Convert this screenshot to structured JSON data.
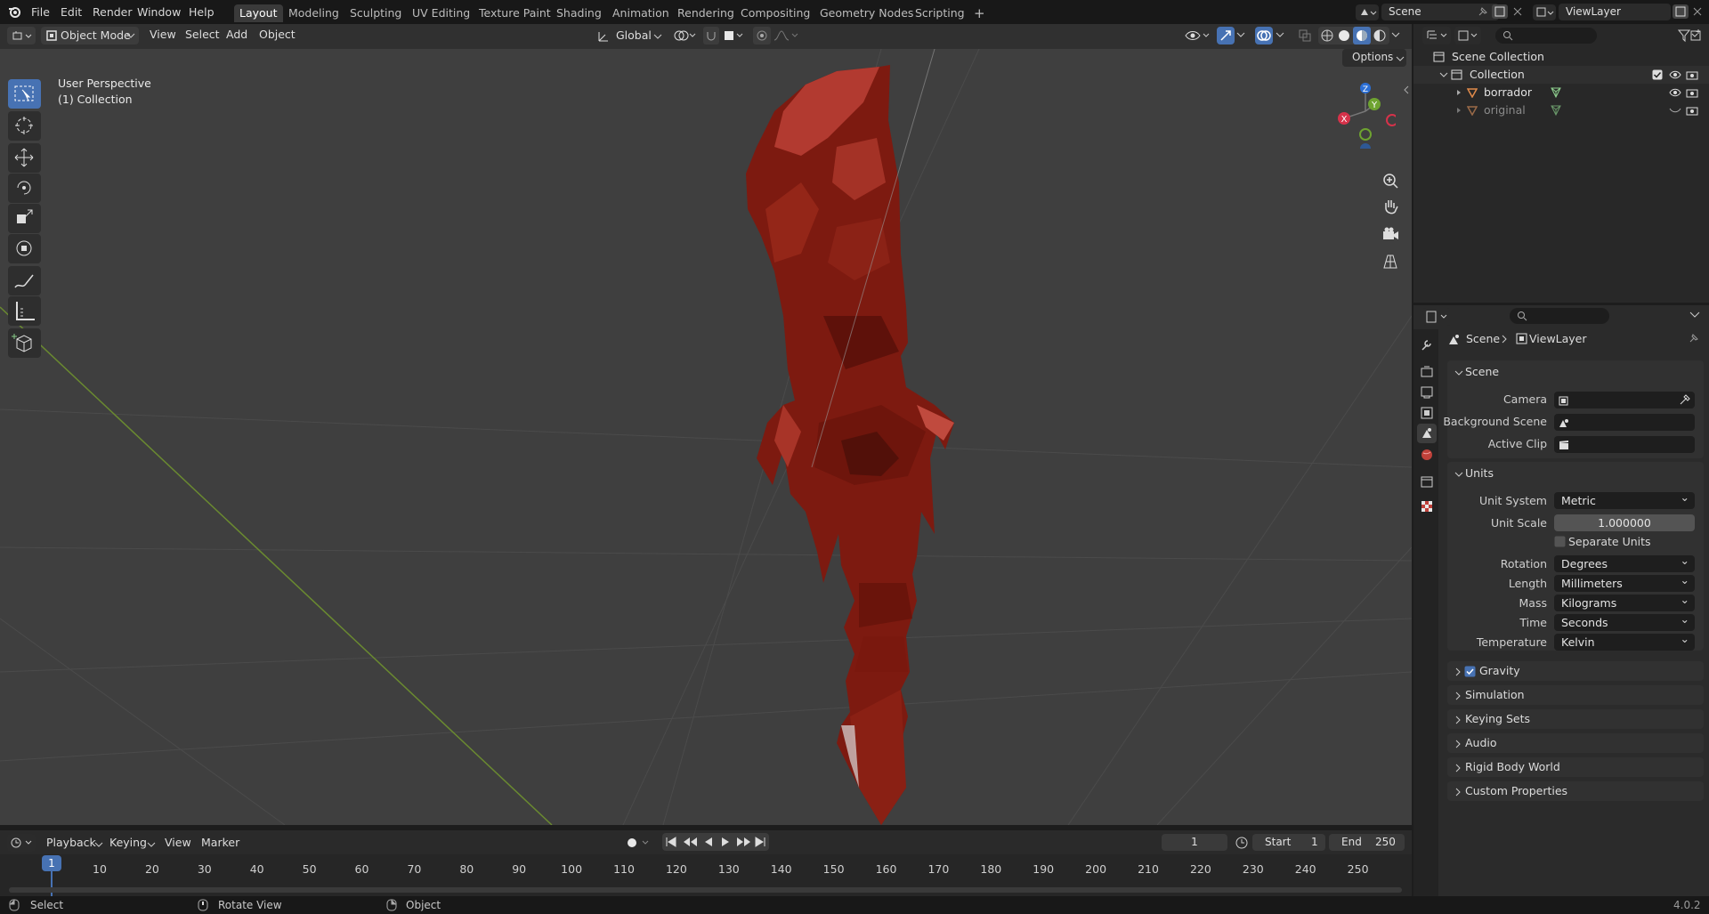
{
  "topbar": {
    "menus": [
      "File",
      "Edit",
      "Render",
      "Window",
      "Help"
    ],
    "workspaces": [
      "Layout",
      "Modeling",
      "Sculpting",
      "UV Editing",
      "Texture Paint",
      "Shading",
      "Animation",
      "Rendering",
      "Compositing",
      "Geometry Nodes",
      "Scripting"
    ],
    "active_workspace": "Layout",
    "add_tab": "+",
    "scene_name": "Scene",
    "view_layer_name": "ViewLayer"
  },
  "viewport_header": {
    "mode": "Object Mode",
    "menus": [
      "View",
      "Select",
      "Add",
      "Object"
    ],
    "orientation": "Global",
    "options_label": "Options"
  },
  "viewport": {
    "overlay_line1": "User Perspective",
    "overlay_line2": "(1) Collection",
    "gizmo_axes": {
      "x": "X",
      "y": "Y",
      "z": "Z"
    },
    "object_color": "#8a1e12",
    "bg_color": "#3f3f3f"
  },
  "outliner": {
    "search_placeholder": "",
    "root": "Scene Collection",
    "collection": "Collection",
    "items": [
      {
        "name": "borrador",
        "dimmed": false
      },
      {
        "name": "original",
        "dimmed": true
      }
    ]
  },
  "properties": {
    "breadcrumb_scene": "Scene",
    "breadcrumb_layer": "ViewLayer",
    "scene_panel": {
      "title": "Scene",
      "camera_label": "Camera",
      "background_scene_label": "Background Scene",
      "active_clip_label": "Active Clip"
    },
    "units_panel": {
      "title": "Units",
      "unit_system_label": "Unit System",
      "unit_system_value": "Metric",
      "unit_scale_label": "Unit Scale",
      "unit_scale_value": "1.000000",
      "separate_units_label": "Separate Units",
      "rotation_label": "Rotation",
      "rotation_value": "Degrees",
      "length_label": "Length",
      "length_value": "Millimeters",
      "mass_label": "Mass",
      "mass_value": "Kilograms",
      "time_label": "Time",
      "time_value": "Seconds",
      "temperature_label": "Temperature",
      "temperature_value": "Kelvin"
    },
    "collapsed_panels": [
      "Gravity",
      "Simulation",
      "Keying Sets",
      "Audio",
      "Rigid Body World",
      "Custom Properties"
    ],
    "gravity_checked": true
  },
  "timeline": {
    "menus": [
      "Playback",
      "Keying",
      "View",
      "Marker"
    ],
    "current_frame": "1",
    "start_label": "Start",
    "start_value": "1",
    "end_label": "End",
    "end_value": "250",
    "ruler": [
      "10",
      "20",
      "30",
      "40",
      "50",
      "60",
      "70",
      "80",
      "90",
      "100",
      "110",
      "120",
      "130",
      "140",
      "150",
      "160",
      "170",
      "180",
      "190",
      "200",
      "210",
      "220",
      "230",
      "240",
      "250"
    ],
    "playhead": "1"
  },
  "statusbar": {
    "select": "Select",
    "rotate": "Rotate View",
    "object": "Object",
    "version": "4.0.2"
  }
}
